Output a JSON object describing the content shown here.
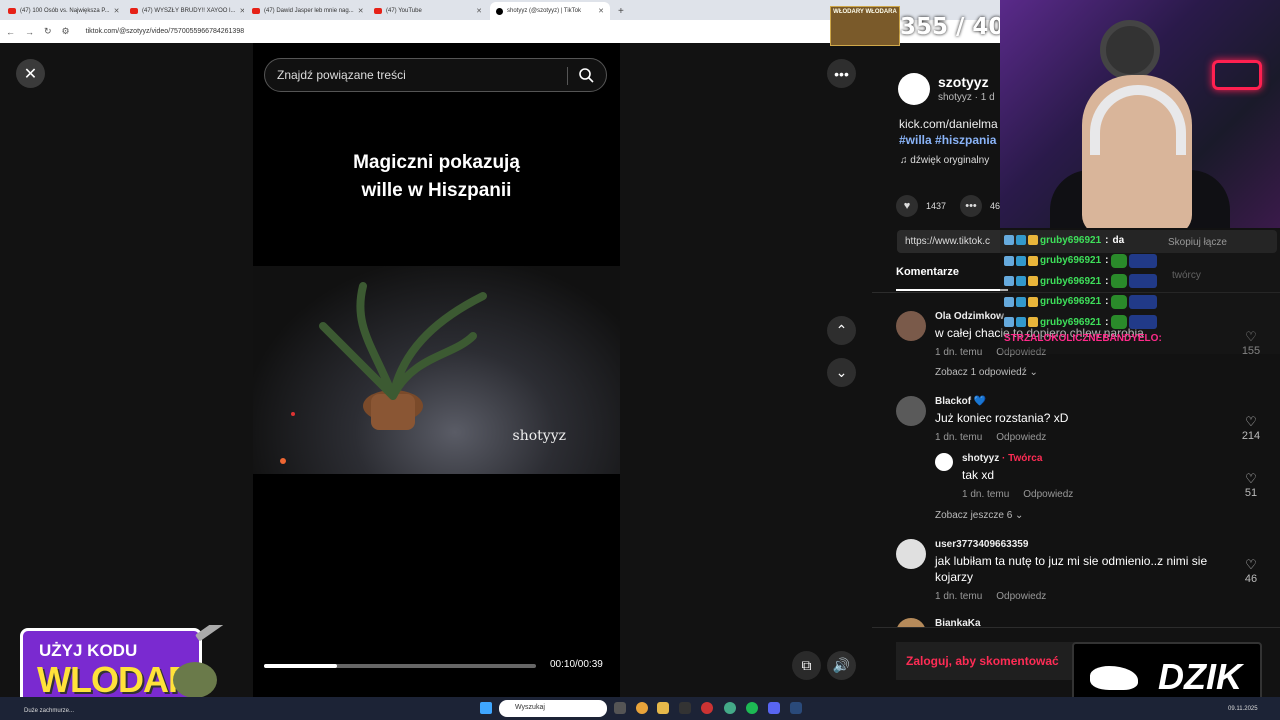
{
  "browser": {
    "tabs": [
      {
        "label": "(47) 100 Osób vs. Największa P...",
        "icon": "youtube-icon"
      },
      {
        "label": "(47) WYSZŁY BRUDY!! XAYOO l...",
        "icon": "youtube-icon"
      },
      {
        "label": "(47) Dawid Jasper leb mnie nag...",
        "icon": "youtube-icon"
      },
      {
        "label": "(47) YouTube",
        "icon": "youtube-icon"
      },
      {
        "label": "shotyyz (@szotyyz) | TikTok",
        "icon": "tiktok-icon"
      }
    ],
    "url": "tiktok.com/@szotyyz/video/7570055966784261398"
  },
  "video": {
    "search_placeholder": "Znajdź powiązane treści",
    "title_line1": "Magiczni pokazują",
    "title_line2": "wille w Hiszpanii",
    "watermark": "shotyyz",
    "time": "00:10/00:39",
    "progress": 0.27
  },
  "panel": {
    "author_name": "szotyyz",
    "author_sub": "shotyyz · 1 d",
    "desc_line1": "kick.com/danielma",
    "desc_hashtags": "#willa #hiszpania",
    "music": "dźwięk oryginalny",
    "likes": "1437",
    "comments_count": "46",
    "link": "https://www.tiktok.c",
    "copy_link": "Skopiuj łącze",
    "tab_comments": "Komentarze",
    "tab_creator": "twórcy",
    "comments": [
      {
        "user": "Ola Odzimkow",
        "text": "w całej chacie to dopiero chlew narobia",
        "time": "1 dn. temu",
        "reply": "Odpowiedz",
        "likes": "155",
        "more": "Zobacz 1 odpowiedź"
      },
      {
        "user": "Blackof 💙",
        "text": "Już koniec rozstania? xD",
        "time": "1 dn. temu",
        "reply": "Odpowiedz",
        "likes": "214"
      },
      {
        "user": "shotyyz",
        "creator_tag": "· Twórca",
        "text": "tak xd",
        "time": "1 dn. temu",
        "reply": "Odpowiedz",
        "likes": "51",
        "more": "Zobacz jeszcze 6"
      },
      {
        "user": "user3773409663359",
        "text": "jak lubiłam ta nutę to juz mi sie odmienio..z nimi sie kojarzy",
        "time": "1 dn. temu",
        "reply": "Odpowiedz",
        "likes": "46"
      },
      {
        "user": "BiankaKa",
        "text": "",
        "time": "",
        "reply": "",
        "likes": ""
      }
    ],
    "login_prompt": "Zaloguj, aby skomentować"
  },
  "overlay": {
    "counter": "355 / 400",
    "counter_label": "WŁODARY WŁODARA",
    "chat": [
      {
        "user": "gruby696921",
        "msg": "da"
      },
      {
        "user": "gruby696921",
        "msg": ""
      },
      {
        "user": "gruby696921",
        "msg": ""
      },
      {
        "user": "gruby696921",
        "msg": ""
      },
      {
        "user": "gruby696921",
        "msg": ""
      }
    ],
    "chat_pink": "STRZALOKOLICZNEBANDYELO:",
    "promo_line1": "UŻYJ KODU",
    "promo_line2": "WLODAR",
    "sponsor": "DZIK"
  },
  "taskbar": {
    "weather": "Duże zachmurze...",
    "search": "Wyszukaj",
    "date": "09.11.2025"
  }
}
